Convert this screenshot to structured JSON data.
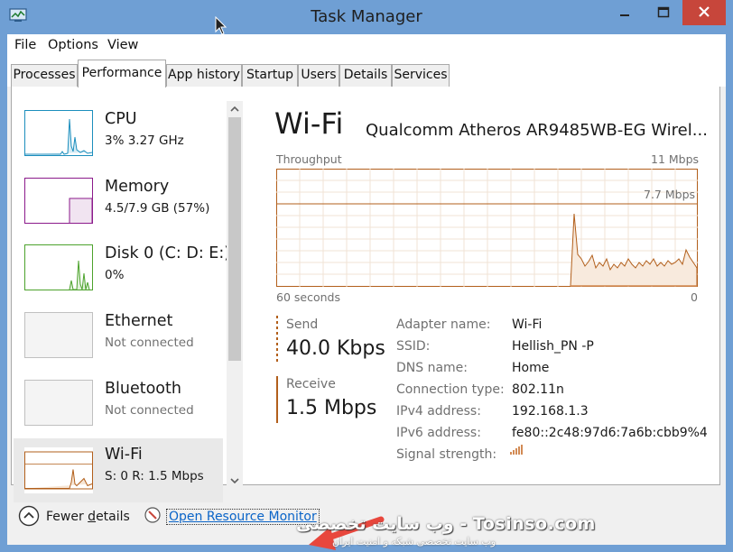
{
  "window": {
    "title": "Task Manager"
  },
  "menu": [
    "File",
    "Options",
    "View"
  ],
  "tabs": [
    "Processes",
    "Performance",
    "App history",
    "Startup",
    "Users",
    "Details",
    "Services"
  ],
  "active_tab": "Performance",
  "sidebar": [
    {
      "title": "CPU",
      "sub": "3%  3.27 GHz",
      "color": "#1c8ebd"
    },
    {
      "title": "Memory",
      "sub": "4.5/7.9 GB (57%)",
      "color": "#8b1a8b"
    },
    {
      "title": "Disk 0 (C: D: E:)",
      "sub": "0%",
      "color": "#4ca22c"
    },
    {
      "title": "Ethernet",
      "sub": "Not connected",
      "color": "#c0c0c0"
    },
    {
      "title": "Bluetooth",
      "sub": "Not connected",
      "color": "#c0c0c0"
    },
    {
      "title": "Wi-Fi",
      "sub": "S: 0  R: 1.5 Mbps",
      "color": "#b25f1b"
    }
  ],
  "detail": {
    "title": "Wi-Fi",
    "adapter": "Qualcomm Atheros AR9485WB-EG Wirel...",
    "graph": {
      "label": "Throughput",
      "max_label": "11 Mbps",
      "mid_label": "7.7 Mbps",
      "x_left": "60 seconds",
      "x_right": "0"
    },
    "send": {
      "label": "Send",
      "value": "40.0 Kbps"
    },
    "receive": {
      "label": "Receive",
      "value": "1.5 Mbps"
    },
    "properties": [
      {
        "label": "Adapter name:",
        "value": "Wi-Fi"
      },
      {
        "label": "SSID:",
        "value": "Hellish_PN -P"
      },
      {
        "label": "DNS name:",
        "value": "Home"
      },
      {
        "label": "Connection type:",
        "value": "802.11n"
      },
      {
        "label": "IPv4 address:",
        "value": "192.168.1.3"
      },
      {
        "label": "IPv6 address:",
        "value": "fe80::2c48:97d6:7a6b:cbb9%4"
      },
      {
        "label": "Signal strength:",
        "value": ""
      }
    ]
  },
  "footer": {
    "fewer_prefix": "Fewer ",
    "fewer_underlined": "d",
    "fewer_suffix": "etails",
    "resource_monitor": "Open Resource Monitor"
  },
  "watermark": "وب سایت تخصصی - Tosinso.com",
  "watermark_sub": "وب سایت تخصصی شبکه و امنیت ایران",
  "colors": {
    "titlebar": "#6f9fd4",
    "wifi_accent": "#b25f1b",
    "link": "#0a64c8",
    "close": "#c7463b"
  }
}
